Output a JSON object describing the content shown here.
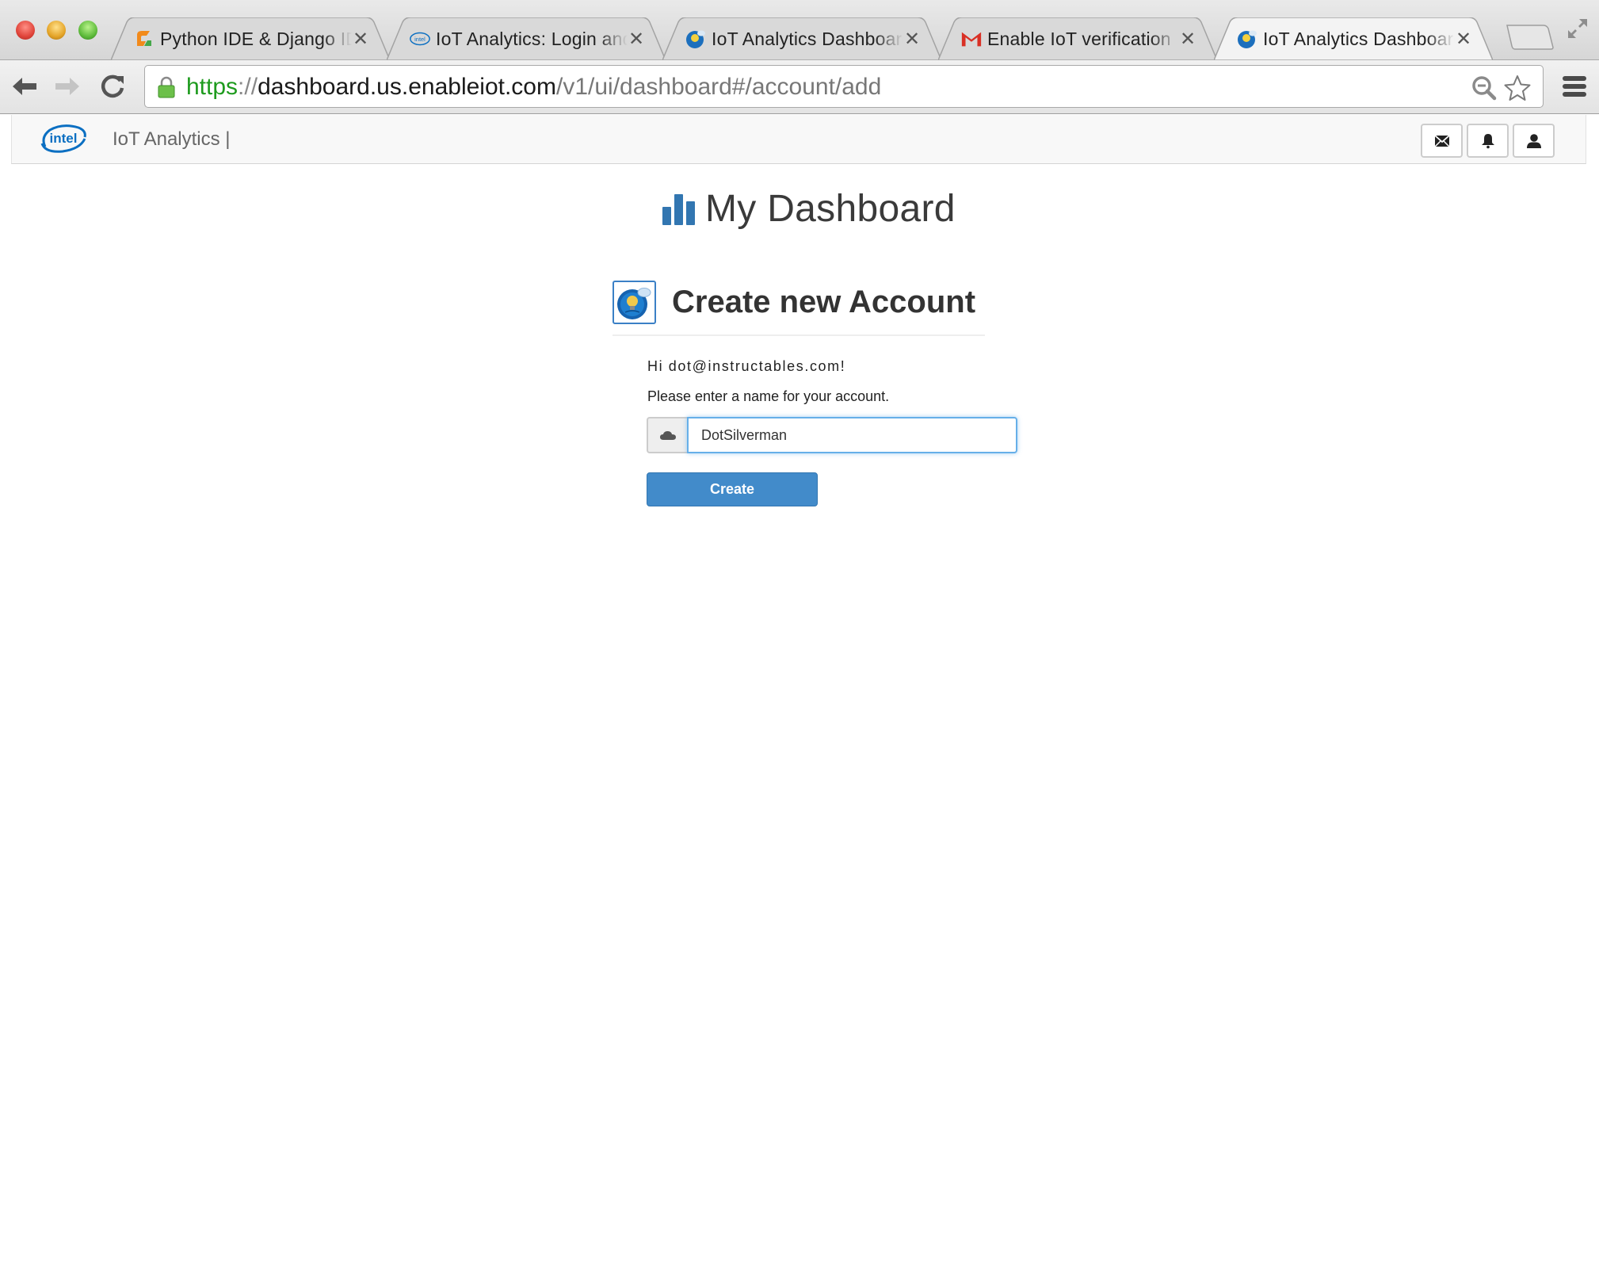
{
  "browser": {
    "tabs": [
      {
        "title": "Python IDE & Django IDE",
        "favicon": "pycharm-icon",
        "active": false
      },
      {
        "title": "IoT Analytics: Login and",
        "favicon": "intel-icon",
        "active": false
      },
      {
        "title": "IoT Analytics Dashboard",
        "favicon": "iot-bulb-icon",
        "active": false
      },
      {
        "title": "Enable IoT verification",
        "favicon": "gmail-icon",
        "active": false
      },
      {
        "title": "IoT Analytics Dashboard",
        "favicon": "iot-bulb-icon",
        "active": true
      }
    ],
    "tab_close_glyph": "✕",
    "url": {
      "scheme": "https",
      "separator": "://",
      "host": "dashboard.us.enableiot.com",
      "path": "/v1/ui/dashboard#/account/add"
    },
    "icons": {
      "back": "back-arrow-icon",
      "forward": "forward-arrow-icon",
      "reload": "reload-icon",
      "lock": "lock-icon",
      "zoom": "zoom-out-icon",
      "bookmark": "star-icon",
      "menu": "hamburger-menu-icon"
    }
  },
  "app_header": {
    "logo_text": "intel",
    "brand": "IoT Analytics |",
    "buttons": [
      {
        "name": "messages",
        "icon": "envelope-icon"
      },
      {
        "name": "notifications",
        "icon": "bell-icon"
      },
      {
        "name": "profile",
        "icon": "user-icon"
      }
    ]
  },
  "page": {
    "title": "My Dashboard",
    "section_title": "Create new Account",
    "greeting": "Hi dot@instructables.com!",
    "prompt": "Please enter a name for your account.",
    "account_name_input": {
      "value": "DotSilverman",
      "addon_icon": "cloud-icon"
    },
    "create_button": "Create"
  },
  "colors": {
    "primary": "#428bca",
    "title_icon": "#3276b1",
    "focus_border": "#66afe9",
    "url_scheme": "#1e9b1e"
  }
}
